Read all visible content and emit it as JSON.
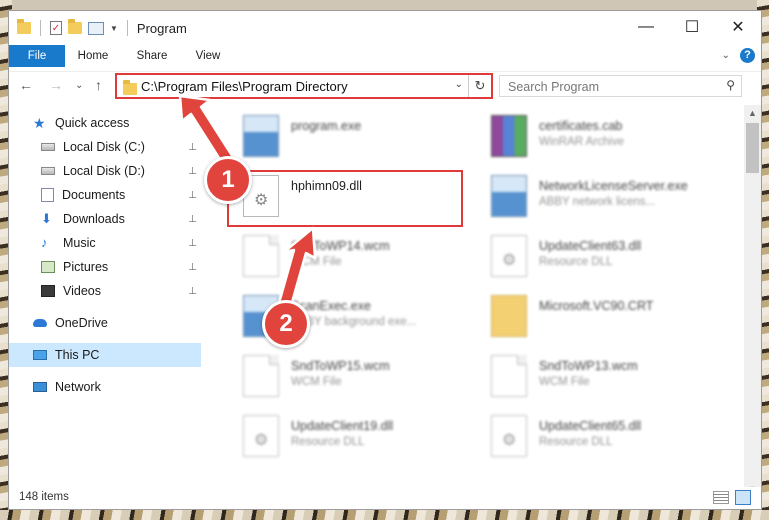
{
  "window": {
    "title": "Program"
  },
  "window_controls": {
    "minimize": "—",
    "maximize": "☐",
    "close": "✕"
  },
  "ribbon": {
    "tabs": [
      "File",
      "Home",
      "Share",
      "View"
    ],
    "help": "?",
    "expand_chevron": "⌄"
  },
  "nav": {
    "back": "←",
    "forward": "→",
    "recent": "⌄",
    "up": "↑",
    "address": "C:\\Program Files\\Program Directory",
    "address_dropdown": "⌄",
    "refresh": "↻",
    "search_placeholder": "Search Program",
    "search_icon": "⚲"
  },
  "sidebar": {
    "items": [
      {
        "label": "Quick access",
        "icon": "star-icon",
        "pinned": false
      },
      {
        "label": "Local Disk (C:)",
        "icon": "drive-icon",
        "pinned": true
      },
      {
        "label": "Local Disk (D:)",
        "icon": "drive-icon",
        "pinned": true
      },
      {
        "label": "Documents",
        "icon": "documents-icon",
        "pinned": true
      },
      {
        "label": "Downloads",
        "icon": "downloads-icon",
        "pinned": true
      },
      {
        "label": "Music",
        "icon": "music-icon",
        "pinned": true
      },
      {
        "label": "Pictures",
        "icon": "pictures-icon",
        "pinned": true
      },
      {
        "label": "Videos",
        "icon": "videos-icon",
        "pinned": true
      },
      {
        "label": "OneDrive",
        "icon": "onedrive-icon",
        "pinned": false
      },
      {
        "label": "This PC",
        "icon": "computer-icon",
        "pinned": false,
        "selected": true
      },
      {
        "label": "Network",
        "icon": "network-icon",
        "pinned": false
      }
    ],
    "pin_glyph": "📌"
  },
  "files": [
    {
      "name": "program.exe",
      "desc": "",
      "icon": "installer-icon",
      "blurred": true
    },
    {
      "name": "certificates.cab",
      "desc": "WinRAR Archive",
      "icon": "winrar-icon",
      "blurred": true
    },
    {
      "name": "hphimn09.dll",
      "desc": "",
      "icon": "dll-icon",
      "blurred": false,
      "highlighted": true
    },
    {
      "name": "NetworkLicenseServer.exe",
      "desc": "ABBY network licens...",
      "icon": "exe-icon",
      "blurred": true
    },
    {
      "name": "SndToWP14.wcm",
      "desc": "WCM File",
      "icon": "file-icon",
      "blurred": true
    },
    {
      "name": "UpdateClient63.dll",
      "desc": "Resource DLL",
      "icon": "dll-icon",
      "blurred": true
    },
    {
      "name": "ScanExec.exe",
      "desc": "ABBY background exe...",
      "icon": "exe-icon",
      "blurred": true
    },
    {
      "name": "Microsoft.VC90.CRT",
      "desc": "",
      "icon": "folder-icon",
      "blurred": true
    },
    {
      "name": "SndToWP15.wcm",
      "desc": "WCM File",
      "icon": "file-icon",
      "blurred": true
    },
    {
      "name": "SndToWP13.wcm",
      "desc": "WCM File",
      "icon": "file-icon",
      "blurred": true
    },
    {
      "name": "UpdateClient19.dll",
      "desc": "Resource DLL",
      "icon": "dll-icon",
      "blurred": true
    },
    {
      "name": "UpdateClient65.dll",
      "desc": "Resource DLL",
      "icon": "dll-icon",
      "blurred": true
    }
  ],
  "status": {
    "items_count": "148 items"
  },
  "annotations": {
    "step1": "1",
    "step2": "2",
    "color": "#e0443c"
  }
}
